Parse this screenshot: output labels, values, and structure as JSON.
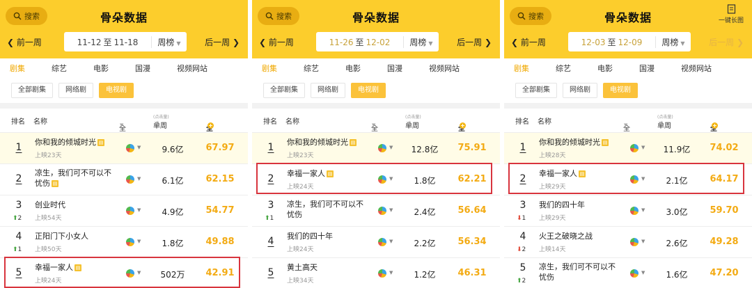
{
  "panels": [
    {
      "search_label": "搜索",
      "title": "骨朵数据",
      "long_image_label": "",
      "prev_week": "前一周",
      "next_week": "后一周",
      "next_disabled": false,
      "date_start": "11-12",
      "date_sep": "至",
      "date_end": "11-18",
      "date_highlight": false,
      "week_select": "周榜",
      "nav_tabs": [
        "剧集",
        "综艺",
        "电影",
        "国漫",
        "视频网站"
      ],
      "sub_tabs": [
        "全部剧集",
        "网络剧",
        "电视剧"
      ],
      "columns": {
        "rank": "排名",
        "name": "名称",
        "platform": "全平台",
        "plays": "单周播放量",
        "plays_note": "(点击量)",
        "heat": "全网热度"
      },
      "rows": [
        {
          "rank": "1",
          "delta": "",
          "dir": "",
          "title": "你和我的倾城时光",
          "sub": "上映23天",
          "plays": "9.6亿",
          "heat": "67.97"
        },
        {
          "rank": "2",
          "delta": "",
          "dir": "",
          "title": "凉生，我们可不可以不忧伤",
          "sub": "",
          "plays": "6.1亿",
          "heat": "62.15"
        },
        {
          "rank": "3",
          "delta": "2",
          "dir": "up",
          "title": "创业时代",
          "sub": "上映54天",
          "plays": "4.9亿",
          "heat": "54.77"
        },
        {
          "rank": "4",
          "delta": "1",
          "dir": "up",
          "title": "正阳门下小女人",
          "sub": "上映50天",
          "plays": "1.8亿",
          "heat": "49.88"
        },
        {
          "rank": "5",
          "delta": "",
          "dir": "",
          "title": "幸福一家人",
          "sub": "上映24天",
          "plays": "502万",
          "heat": "42.91"
        }
      ],
      "highlight_row": 4
    },
    {
      "search_label": "搜索",
      "title": "骨朵数据",
      "long_image_label": "",
      "prev_week": "前一周",
      "next_week": "后一周",
      "next_disabled": false,
      "date_start": "11-26",
      "date_sep": "至",
      "date_end": "12-02",
      "date_highlight": true,
      "week_select": "周榜",
      "nav_tabs": [
        "剧集",
        "综艺",
        "电影",
        "国漫",
        "视频网站"
      ],
      "sub_tabs": [
        "全部剧集",
        "网络剧",
        "电视剧"
      ],
      "columns": {
        "rank": "排名",
        "name": "名称",
        "platform": "全平台",
        "plays": "单周播放量",
        "plays_note": "(点击量)",
        "heat": "全网热度"
      },
      "rows": [
        {
          "rank": "1",
          "delta": "",
          "dir": "",
          "title": "你和我的倾城时光",
          "sub": "上映23天",
          "plays": "12.8亿",
          "heat": "75.91"
        },
        {
          "rank": "2",
          "delta": "",
          "dir": "",
          "title": "幸福一家人",
          "sub": "上映24天",
          "plays": "1.8亿",
          "heat": "62.21"
        },
        {
          "rank": "3",
          "delta": "1",
          "dir": "up",
          "title": "凉生，我们可不可以不忧伤",
          "sub": "",
          "plays": "2.4亿",
          "heat": "56.64"
        },
        {
          "rank": "4",
          "delta": "",
          "dir": "",
          "title": "我们的四十年",
          "sub": "上映24天",
          "plays": "2.2亿",
          "heat": "56.34"
        },
        {
          "rank": "5",
          "delta": "",
          "dir": "",
          "title": "黄土高天",
          "sub": "上映34天",
          "plays": "1.2亿",
          "heat": "46.31"
        }
      ],
      "highlight_row": 1
    },
    {
      "search_label": "搜索",
      "title": "骨朵数据",
      "long_image_label": "一键长图",
      "prev_week": "前一周",
      "next_week": "后一周",
      "next_disabled": true,
      "date_start": "12-03",
      "date_sep": "至",
      "date_end": "12-09",
      "date_highlight": true,
      "week_select": "周榜",
      "nav_tabs": [
        "剧集",
        "综艺",
        "电影",
        "国漫",
        "视频网站"
      ],
      "sub_tabs": [
        "全部剧集",
        "网络剧",
        "电视剧"
      ],
      "columns": {
        "rank": "排名",
        "name": "名称",
        "platform": "全平台",
        "plays": "单周播放量",
        "plays_note": "(点击量)",
        "heat": "全网热度"
      },
      "rows": [
        {
          "rank": "1",
          "delta": "",
          "dir": "",
          "title": "你和我的倾城时光",
          "sub": "上映28天",
          "plays": "11.9亿",
          "heat": "74.02"
        },
        {
          "rank": "2",
          "delta": "",
          "dir": "",
          "title": "幸福一家人",
          "sub": "上映29天",
          "plays": "2.1亿",
          "heat": "64.17"
        },
        {
          "rank": "3",
          "delta": "1",
          "dir": "down",
          "title": "我们的四十年",
          "sub": "上映29天",
          "plays": "3.0亿",
          "heat": "59.70"
        },
        {
          "rank": "4",
          "delta": "2",
          "dir": "down",
          "title": "火王之破晓之战",
          "sub": "上映14天",
          "plays": "2.6亿",
          "heat": "49.28"
        },
        {
          "rank": "5",
          "delta": "2",
          "dir": "up",
          "title": "凉生，我们可不可以不忧伤",
          "sub": "",
          "plays": "1.6亿",
          "heat": "47.20"
        }
      ],
      "highlight_row": 1
    }
  ],
  "colors": {
    "header_bg": "#fccd2c",
    "accent": "#f3ab14",
    "highlight_box": "#d8343d",
    "rank_up": "#46a541",
    "rank_down": "#e14b3a"
  },
  "icons": {
    "search": "magnifier-icon",
    "platform": "pie-chart-icon",
    "long_image": "document-icon"
  }
}
